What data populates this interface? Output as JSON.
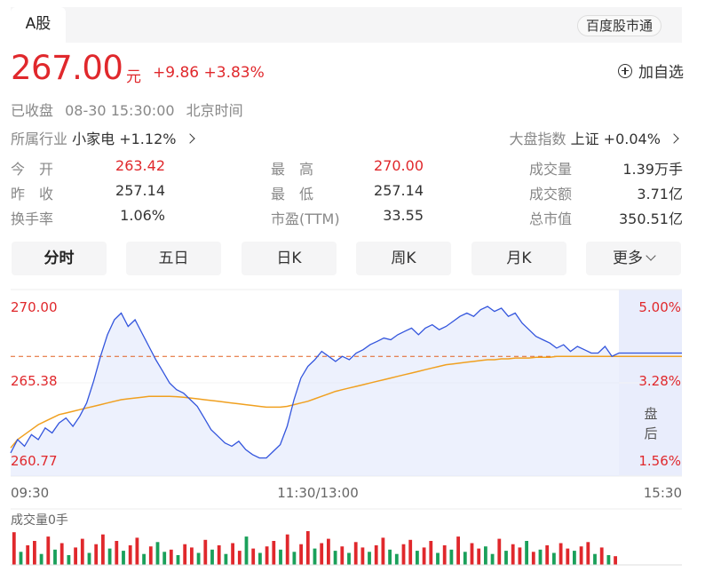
{
  "tabs": {
    "active": "A股",
    "right_badge": "百度股市通"
  },
  "quote": {
    "price": "267.00",
    "unit": "元",
    "change": "+9.86",
    "change_pct": "+3.83%",
    "add_watch": "加自选"
  },
  "status": {
    "state": "已收盘",
    "datetime": "08-30 15:30:00",
    "tz": "北京时间"
  },
  "industry": {
    "label": "所属行业",
    "name": "小家电",
    "change": "+1.12%"
  },
  "market_index": {
    "label": "大盘指数",
    "name": "上证",
    "change": "+0.04%"
  },
  "stats": [
    {
      "label": "今　开",
      "value": "263.42",
      "color": "#e0282c"
    },
    {
      "label": "最　高",
      "value": "270.00",
      "color": "#e0282c"
    },
    {
      "label": "成交量",
      "value": "1.39万手",
      "color": "#333333"
    },
    {
      "label": "昨　收",
      "value": "257.14",
      "color": "#333333"
    },
    {
      "label": "最　低",
      "value": "257.14",
      "color": "#333333"
    },
    {
      "label": "成交额",
      "value": "3.71亿",
      "color": "#333333"
    },
    {
      "label": "换手率",
      "value": "1.06%",
      "color": "#333333"
    },
    {
      "label": "市盈(TTM)",
      "value": "33.55",
      "color": "#333333"
    },
    {
      "label": "总市值",
      "value": "350.51亿",
      "color": "#333333"
    }
  ],
  "period_buttons": [
    "分时",
    "五日",
    "日K",
    "周K",
    "月K",
    "更多"
  ],
  "chart_data": {
    "type": "line",
    "y_ticks_left": [
      "270.00",
      "265.38",
      "260.77"
    ],
    "y_ticks_right": [
      "5.00%",
      "3.28%",
      "1.56%"
    ],
    "x_ticks": [
      "09:30",
      "11:30/13:00",
      "15:30"
    ],
    "after_hours_label": [
      "盘",
      "后"
    ],
    "volume_label": "成交量0手",
    "ylim": [
      260.77,
      270.0
    ],
    "prev_ref": 267.0,
    "price_series": [
      261.2,
      262.0,
      261.6,
      262.3,
      262.0,
      262.7,
      262.4,
      263.0,
      263.3,
      262.8,
      263.4,
      264.2,
      265.5,
      267.0,
      268.3,
      269.2,
      269.6,
      268.8,
      269.2,
      268.4,
      267.6,
      266.8,
      266.1,
      265.4,
      265.0,
      264.8,
      264.4,
      264.0,
      263.3,
      262.6,
      262.2,
      261.8,
      261.6,
      261.9,
      261.4,
      261.1,
      260.9,
      260.9,
      261.3,
      261.7,
      262.8,
      264.4,
      265.7,
      266.4,
      266.8,
      267.3,
      267.0,
      266.7,
      267.0,
      266.8,
      267.2,
      267.4,
      267.7,
      267.9,
      268.1,
      268.0,
      268.3,
      268.5,
      268.7,
      268.3,
      268.7,
      268.9,
      268.6,
      268.8,
      269.1,
      269.4,
      269.6,
      269.4,
      269.8,
      270.0,
      269.7,
      269.9,
      269.4,
      269.6,
      269.0,
      268.6,
      268.2,
      268.0,
      267.8,
      267.5,
      267.7,
      267.3,
      267.6,
      267.4,
      267.2,
      267.2,
      267.6,
      267.0,
      267.2
    ],
    "avg_series": [
      261.5,
      262.0,
      262.3,
      262.6,
      262.9,
      263.1,
      263.3,
      263.5,
      263.6,
      263.7,
      263.8,
      263.9,
      264.0,
      264.1,
      264.2,
      264.3,
      264.4,
      264.45,
      264.5,
      264.55,
      264.6,
      264.6,
      264.6,
      264.6,
      264.58,
      264.55,
      264.5,
      264.45,
      264.4,
      264.35,
      264.3,
      264.25,
      264.2,
      264.15,
      264.1,
      264.05,
      264.0,
      263.95,
      263.95,
      263.95,
      264.0,
      264.1,
      264.2,
      264.3,
      264.45,
      264.6,
      264.75,
      264.9,
      265.0,
      265.1,
      265.2,
      265.3,
      265.4,
      265.5,
      265.6,
      265.7,
      265.8,
      265.9,
      266.0,
      266.1,
      266.2,
      266.3,
      266.4,
      266.5,
      266.55,
      266.6,
      266.65,
      266.7,
      266.75,
      266.8,
      266.8,
      266.85,
      266.85,
      266.9,
      266.9,
      266.9,
      266.95,
      266.95,
      266.95,
      267.0,
      267.0,
      267.0,
      267.0,
      267.0,
      267.0,
      267.0,
      267.0,
      267.0,
      267.0
    ],
    "volume_series": [
      30,
      12,
      18,
      22,
      10,
      26,
      14,
      20,
      9,
      16,
      24,
      11,
      19,
      28,
      15,
      22,
      13,
      18,
      25,
      10,
      17,
      21,
      12,
      14,
      9,
      19,
      16,
      11,
      23,
      14,
      18,
      10,
      20,
      13,
      26,
      15,
      11,
      17,
      22,
      14,
      28,
      12,
      19,
      31,
      15,
      20,
      24,
      13,
      17,
      11,
      21,
      16,
      12,
      18,
      25,
      14,
      10,
      19,
      23,
      13,
      16,
      22,
      11,
      18,
      14,
      26,
      12,
      20,
      15,
      17,
      10,
      24,
      13,
      19,
      16,
      22,
      12,
      14,
      18,
      11,
      20,
      15,
      13,
      17,
      21,
      10,
      16,
      9,
      8
    ],
    "volume_up": [
      true,
      false,
      true,
      true,
      false,
      true,
      false,
      true,
      false,
      true,
      true,
      false,
      true,
      true,
      false,
      true,
      false,
      true,
      true,
      false,
      true,
      false,
      false,
      true,
      false,
      true,
      true,
      false,
      true,
      false,
      true,
      false,
      true,
      true,
      false,
      true,
      false,
      true,
      true,
      false,
      true,
      false,
      true,
      true,
      false,
      true,
      true,
      false,
      true,
      false,
      true,
      true,
      false,
      true,
      true,
      false,
      false,
      true,
      true,
      false,
      true,
      true,
      false,
      true,
      false,
      true,
      false,
      true,
      true,
      false,
      false,
      true,
      false,
      true,
      true,
      false,
      true,
      false,
      true,
      false,
      true,
      true,
      false,
      true,
      true,
      false,
      true,
      false,
      true
    ],
    "colors": {
      "price_line": "#3355dd",
      "avg_line": "#f0a020",
      "ref_line": "#e06020",
      "up": "#e0282c",
      "down": "#1aa05a"
    }
  }
}
